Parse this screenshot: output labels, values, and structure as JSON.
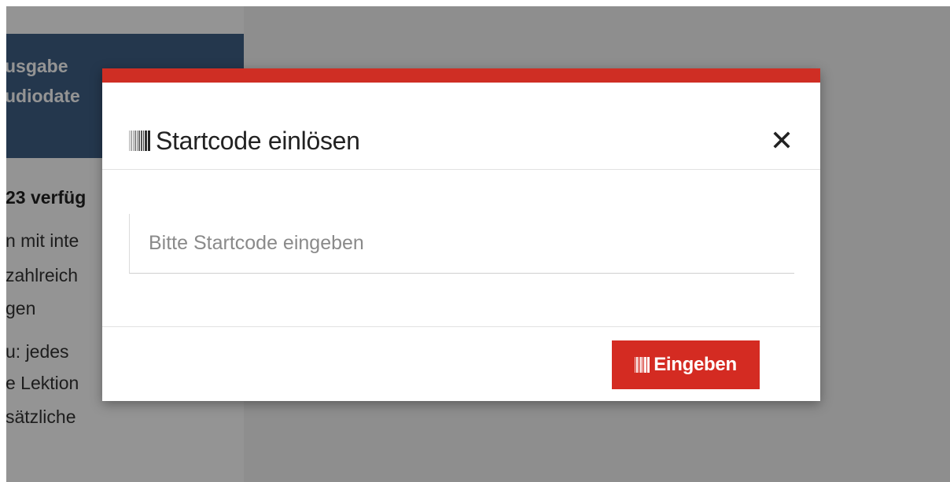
{
  "background_page": {
    "card_lines": [
      "usgabe",
      "udiodate"
    ],
    "availability_text": "23 verfüg",
    "body_lines": [
      "n mit inte",
      "zahlreich",
      "gen",
      "u: jedes",
      "e Lektion",
      "sätzliche"
    ]
  },
  "modal": {
    "title": "Startcode einlösen",
    "icons": {
      "title_icon": "barcode-icon",
      "close_icon": "close-icon",
      "button_icon": "barcode-icon"
    },
    "input": {
      "placeholder": "Bitte Startcode eingeben",
      "value": ""
    },
    "submit_label": "Eingeben"
  },
  "colors": {
    "accent_red": "#cf2e24",
    "button_red": "#d42b22",
    "card_blue": "#3f5f86"
  }
}
